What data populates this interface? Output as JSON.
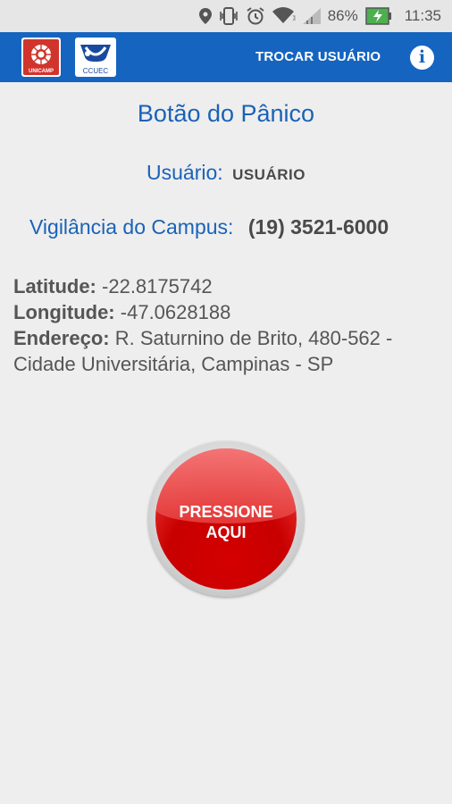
{
  "status_bar": {
    "battery": "86%",
    "time": "11:35",
    "icons": [
      "location-icon",
      "vibrate-icon",
      "alarm-icon",
      "wifi-icon",
      "signal-icon",
      "battery-charging-icon"
    ]
  },
  "app_bar": {
    "logos": [
      "UNICAMP",
      "CCUEC"
    ],
    "switch_user": "TROCAR USUÁRIO",
    "info": "i",
    "color": "#1565c0"
  },
  "main": {
    "title": "Botão do Pânico",
    "user_label": "Usuário:",
    "user_value": "USUÁRIO",
    "security_label": "Vigilância do Campus:",
    "security_phone": "(19) 3521-6000",
    "latitude_label": "Latitude:",
    "latitude_value": "-22.8175742",
    "longitude_label": "Longitude:",
    "longitude_value": "-47.0628188",
    "address_label": "Endereço:",
    "address_value": "R. Saturnino de Brito, 480-562 - Cidade Universitária, Campinas - SP"
  },
  "panic_button": {
    "line1": "PRESSIONE",
    "line2": "AQUI",
    "color": "#d40000"
  }
}
